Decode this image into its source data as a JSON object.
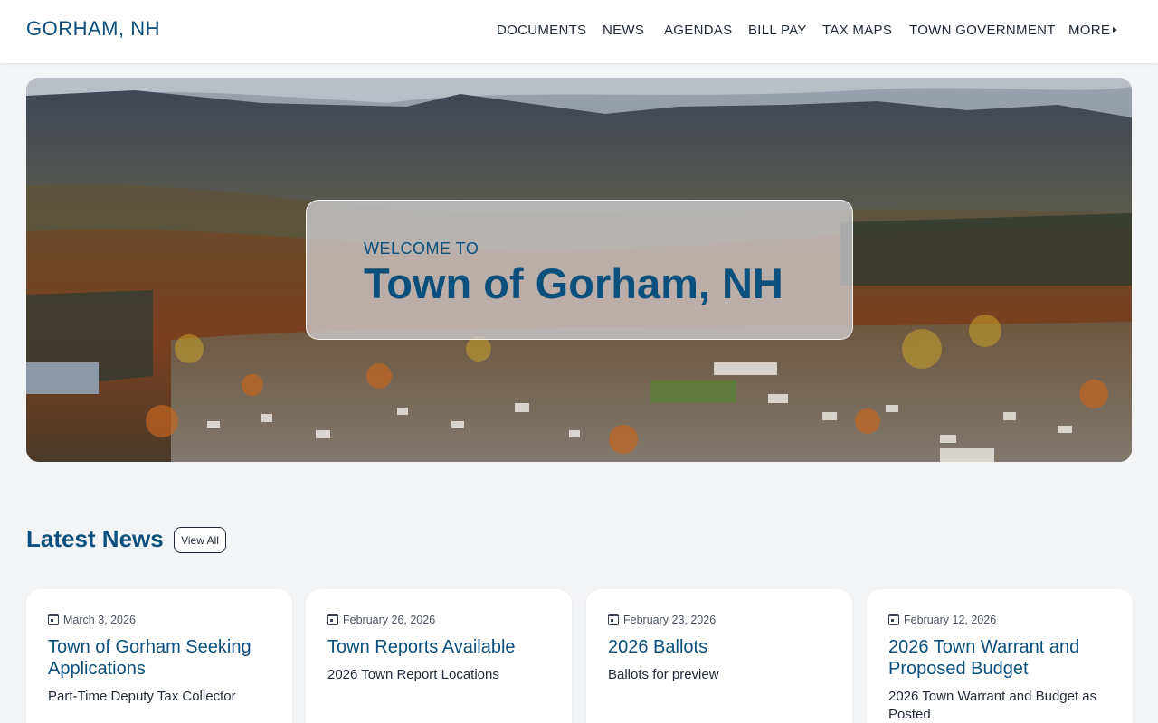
{
  "header": {
    "logo": "GORHAM, NH",
    "nav": [
      "DOCUMENTS",
      "NEWS",
      "AGENDAS",
      "BILL PAY",
      "TAX MAPS",
      "TOWN GOVERNMENT"
    ],
    "more_label": "MORE"
  },
  "hero": {
    "welcome_pre": "WELCOME TO",
    "welcome_title": "Town of Gorham, NH"
  },
  "news": {
    "title": "Latest News",
    "view_all": "View All",
    "cards": [
      {
        "date": "March 3, 2026",
        "title": "Town of Gorham Seeking Applications",
        "subtitle": "Part-Time Deputy Tax Collector"
      },
      {
        "date": "February 26, 2026",
        "title": "Town Reports Available",
        "subtitle": "2026 Town Report Locations"
      },
      {
        "date": "February 23, 2026",
        "title": "2026 Ballots",
        "subtitle": "Ballots for preview"
      },
      {
        "date": "February 12, 2026",
        "title": "2026 Town Warrant and Proposed Budget",
        "subtitle": "2026 Town Warrant and Budget as Posted"
      }
    ]
  },
  "colors": {
    "brand": "#0b4f7c",
    "page_bg": "#f3f4f6"
  },
  "icons": {
    "calendar": "calendar-icon",
    "more_caret": "caret-right-icon"
  }
}
